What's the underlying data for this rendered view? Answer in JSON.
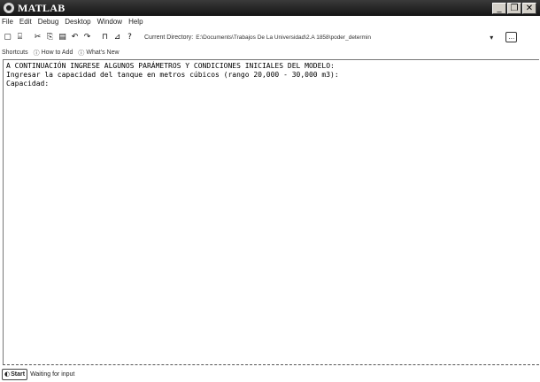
{
  "window": {
    "title": "MATLAB"
  },
  "menubar": {
    "items": [
      "File",
      "Edit",
      "Debug",
      "Desktop",
      "Window",
      "Help"
    ]
  },
  "toolbar": {
    "current_directory_label": "Current Directory:",
    "current_directory_value": "E:\\Documents\\Trabajos De La Universidad\\2.A 1858\\poder_determin"
  },
  "shortcuts": {
    "label": "Shortcuts",
    "items": [
      "How to Add",
      "What's New"
    ]
  },
  "command_window": {
    "lines": [
      "A CONTINUACIÓN INGRESE ALGUNOS PARÁMETROS Y CONDICIONES INICIALES DEL MODELO:",
      "Ingresar la capacidad del tanque en metros cúbicos (rango 20,000 - 30,000 m3):",
      "Capacidad:"
    ]
  },
  "status": {
    "start_label": "Start",
    "text": "Waiting for input"
  },
  "icons": {
    "title_controls": [
      "minimize-icon",
      "restore-icon",
      "close-icon"
    ]
  }
}
